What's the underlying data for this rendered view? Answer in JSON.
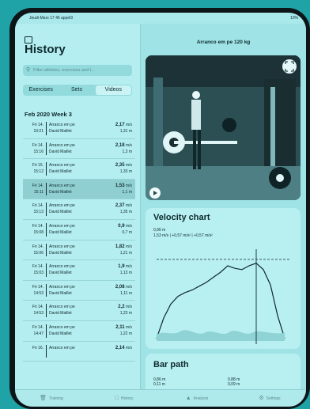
{
  "status": {
    "time": "Jeudi-Mars 17 46 appel3",
    "battery": "10%"
  },
  "sidebar": {
    "title": "History",
    "search_placeholder": "Filter athletes, exercises and t...",
    "tabs": [
      "Exercises",
      "Sets",
      "Videos"
    ],
    "active_tab": "Videos",
    "week": "Feb 2020 Week 3",
    "rows": [
      {
        "day": "Fri 14.",
        "time": "10:21",
        "name": "Arranco em pe",
        "athlete": "David Maillet",
        "speed": "2,17",
        "unit": "m/s",
        "dist": "1,31 m"
      },
      {
        "day": "Fri 14.",
        "time": "15:16",
        "name": "Arranco em pe",
        "athlete": "David Maillet",
        "speed": "2,18",
        "unit": "m/s",
        "dist": "1,3 m"
      },
      {
        "day": "Fri 15.",
        "time": "15:12",
        "name": "Arranco em pe",
        "athlete": "David Maillet",
        "speed": "2,35",
        "unit": "m/s",
        "dist": "1,33 m"
      },
      {
        "day": "Fri 14.",
        "time": "15:11",
        "name": "Arranco em pe",
        "athlete": "David Maillet",
        "speed": "1,53",
        "unit": "m/s",
        "dist": "1,1 m"
      },
      {
        "day": "Fri 14.",
        "time": "15:13",
        "name": "Arranco em pe",
        "athlete": "David Maillet",
        "speed": "2,37",
        "unit": "m/s",
        "dist": "1,35 m"
      },
      {
        "day": "Fri 14.",
        "time": "15:08",
        "name": "Arranco em pe",
        "athlete": "David Maillet",
        "speed": "0,9",
        "unit": "m/s",
        "dist": "0,7 m"
      },
      {
        "day": "Fri 14.",
        "time": "15:06",
        "name": "Arranco em pe",
        "athlete": "David Maillet",
        "speed": "1,82",
        "unit": "m/s",
        "dist": "1,21 m"
      },
      {
        "day": "Fri 14.",
        "time": "15:03",
        "name": "Arranco em pe",
        "athlete": "David Maillet",
        "speed": "1,9",
        "unit": "m/s",
        "dist": "1,13 m"
      },
      {
        "day": "Fri 14.",
        "time": "14:53",
        "name": "Arranco em pe",
        "athlete": "David Maillet",
        "speed": "2,08",
        "unit": "m/s",
        "dist": "1,11 m"
      },
      {
        "day": "Fri 14.",
        "time": "14:53",
        "name": "Arranco em pe",
        "athlete": "David Maillet",
        "speed": "2,2",
        "unit": "m/s",
        "dist": "1,23 m"
      },
      {
        "day": "Fri 14.",
        "time": "14:47",
        "name": "Arranco em pe",
        "athlete": "David Maillet",
        "speed": "2,11",
        "unit": "m/s",
        "dist": "1,22 m"
      },
      {
        "day": "Fri 16.",
        "time": "",
        "name": "Arranco em pe",
        "athlete": "",
        "speed": "2,14",
        "unit": "m/s",
        "dist": ""
      }
    ]
  },
  "main": {
    "title": "Arranco em pe 120 kg",
    "velocity": {
      "title": "Velocity chart",
      "line1": "0,96 m",
      "line2": "1,53 m/s | +0,57 m/s² | +0,57 m/s²"
    },
    "barpath": {
      "title": "Bar path",
      "left": [
        "0,86 m",
        "0,11 m"
      ],
      "right": [
        "0,88 m",
        "0,09 m"
      ]
    }
  },
  "tabbar": [
    {
      "label": "Training",
      "icon": "trash-icon"
    },
    {
      "label": "History",
      "icon": "folder-icon"
    },
    {
      "label": "Analysis",
      "icon": "chart-icon"
    },
    {
      "label": "Settings",
      "icon": "gear-icon"
    }
  ],
  "chart_data": {
    "type": "line",
    "x": [
      0.0,
      0.05,
      0.1,
      0.15,
      0.2,
      0.25,
      0.3,
      0.35,
      0.4,
      0.45,
      0.5,
      0.55,
      0.6,
      0.65,
      0.7,
      0.75,
      0.8,
      0.85,
      0.9
    ],
    "y": [
      0.1,
      0.9,
      1.45,
      1.75,
      1.9,
      2.0,
      2.15,
      2.3,
      2.5,
      2.7,
      2.95,
      2.85,
      2.8,
      2.95,
      3.05,
      2.8,
      2.2,
      1.0,
      0.1
    ],
    "xlim": [
      0,
      0.9
    ],
    "ylim": [
      0,
      3.6
    ],
    "annotations": [
      {
        "type": "hline",
        "y": 3.2
      },
      {
        "type": "vline",
        "x": 0.7
      }
    ],
    "grid": false
  }
}
